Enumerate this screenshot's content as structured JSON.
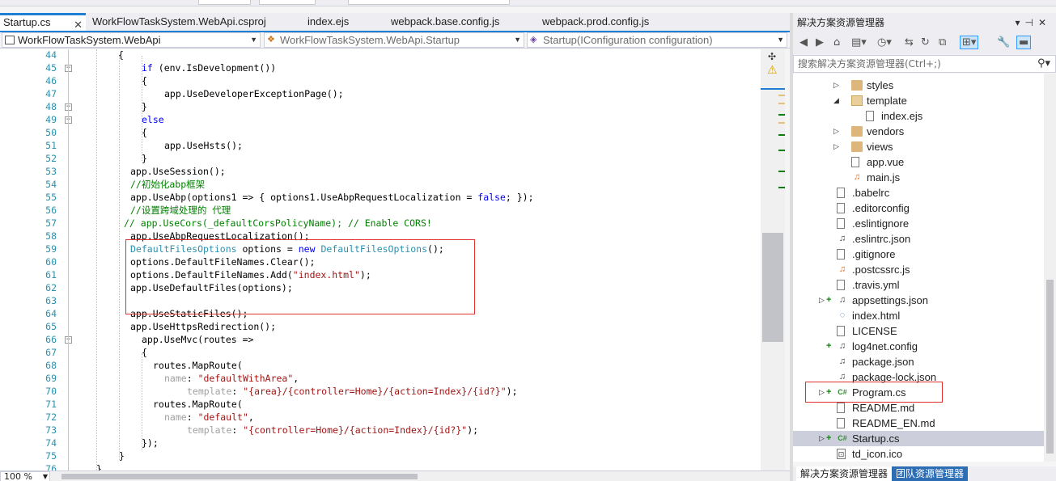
{
  "tabs": [
    {
      "label": "Startup.cs",
      "active": true
    },
    {
      "label": "WorkFlowTaskSystem.WebApi.csproj",
      "active": false
    },
    {
      "label": "index.ejs",
      "active": false
    },
    {
      "label": "webpack.base.config.js",
      "active": false
    },
    {
      "label": "webpack.prod.config.js",
      "active": false
    }
  ],
  "nav": {
    "project": "WorkFlowTaskSystem.WebApi",
    "class": "WorkFlowTaskSystem.WebApi.Startup",
    "member": "Startup(IConfiguration configuration)"
  },
  "code_lines": [
    {
      "n": "44",
      "text": "{"
    },
    {
      "n": "45",
      "text": "if (env.IsDevelopment())"
    },
    {
      "n": "46",
      "text": "{"
    },
    {
      "n": "47",
      "text": "app.UseDeveloperExceptionPage();"
    },
    {
      "n": "48",
      "text": "}"
    },
    {
      "n": "49",
      "text": "else"
    },
    {
      "n": "50",
      "text": "{"
    },
    {
      "n": "51",
      "text": "app.UseHsts();"
    },
    {
      "n": "52",
      "text": "}"
    },
    {
      "n": "53",
      "text": "app.UseSession();"
    },
    {
      "n": "54",
      "text": "//初始化abp框架"
    },
    {
      "n": "55",
      "text": "app.UseAbp(options1 => { options1.UseAbpRequestLocalization = false; });"
    },
    {
      "n": "56",
      "text": "//设置跨域处理的 代理"
    },
    {
      "n": "57",
      "text": "// app.UseCors(_defaultCorsPolicyName); // Enable CORS!"
    },
    {
      "n": "58",
      "text": "app.UseAbpRequestLocalization();"
    },
    {
      "n": "59",
      "text": "DefaultFilesOptions options = new DefaultFilesOptions();"
    },
    {
      "n": "60",
      "text": "options.DefaultFileNames.Clear();"
    },
    {
      "n": "61",
      "text": "options.DefaultFileNames.Add(\"index.html\");"
    },
    {
      "n": "62",
      "text": "app.UseDefaultFiles(options);"
    },
    {
      "n": "63",
      "text": ""
    },
    {
      "n": "64",
      "text": "app.UseStaticFiles();"
    },
    {
      "n": "65",
      "text": "app.UseHttpsRedirection();"
    },
    {
      "n": "66",
      "text": "app.UseMvc(routes =>"
    },
    {
      "n": "67",
      "text": "{"
    },
    {
      "n": "68",
      "text": "routes.MapRoute("
    },
    {
      "n": "69",
      "text": "name: \"defaultWithArea\","
    },
    {
      "n": "70",
      "text": "template: \"{area}/{controller=Home}/{action=Index}/{id?}\");"
    },
    {
      "n": "71",
      "text": "routes.MapRoute("
    },
    {
      "n": "72",
      "text": "name: \"default\","
    },
    {
      "n": "73",
      "text": "template: \"{controller=Home}/{action=Index}/{id?}\");"
    },
    {
      "n": "74",
      "text": "});"
    },
    {
      "n": "75",
      "text": "}"
    },
    {
      "n": "76",
      "text": "}"
    }
  ],
  "zoom": "100 %",
  "solution_explorer": {
    "title": "解决方案资源管理器",
    "search_placeholder": "搜索解决方案资源管理器(Ctrl+;)",
    "items": [
      {
        "label": "styles",
        "icon": "folder-icon"
      },
      {
        "label": "template",
        "icon": "folder-open-icon"
      },
      {
        "label": "index.ejs",
        "icon": "file-icon"
      },
      {
        "label": "vendors",
        "icon": "folder-icon"
      },
      {
        "label": "views",
        "icon": "folder-icon"
      },
      {
        "label": "app.vue",
        "icon": "file-icon"
      },
      {
        "label": "main.js",
        "icon": "js-file-icon"
      },
      {
        "label": ".babelrc",
        "icon": "file-icon"
      },
      {
        "label": ".editorconfig",
        "icon": "file-icon"
      },
      {
        "label": ".eslintignore",
        "icon": "file-icon"
      },
      {
        "label": ".eslintrc.json",
        "icon": "config-file-icon"
      },
      {
        "label": ".gitignore",
        "icon": "file-icon"
      },
      {
        "label": ".postcssrc.js",
        "icon": "js-file-icon"
      },
      {
        "label": ".travis.yml",
        "icon": "file-icon"
      },
      {
        "label": "appsettings.json",
        "icon": "config-file-icon"
      },
      {
        "label": "index.html",
        "icon": "html-file-icon"
      },
      {
        "label": "LICENSE",
        "icon": "file-icon"
      },
      {
        "label": "log4net.config",
        "icon": "config-file-icon"
      },
      {
        "label": "package.json",
        "icon": "config-file-icon"
      },
      {
        "label": "package-lock.json",
        "icon": "config-file-icon"
      },
      {
        "label": "Program.cs",
        "icon": "csharp-file-icon"
      },
      {
        "label": "README.md",
        "icon": "file-icon"
      },
      {
        "label": "README_EN.md",
        "icon": "file-icon"
      },
      {
        "label": "Startup.cs",
        "icon": "csharp-file-icon"
      },
      {
        "label": "td_icon.ico",
        "icon": "ico-file-icon"
      }
    ],
    "bottom_tabs": [
      "解决方案资源管理器",
      "团队资源管理器"
    ]
  },
  "colors": {
    "accent": "#1e7fd5",
    "highlight_box": "#e03030",
    "keyword": "#0000ff",
    "type": "#2b91af",
    "string": "#a31515",
    "comment": "#008000"
  }
}
